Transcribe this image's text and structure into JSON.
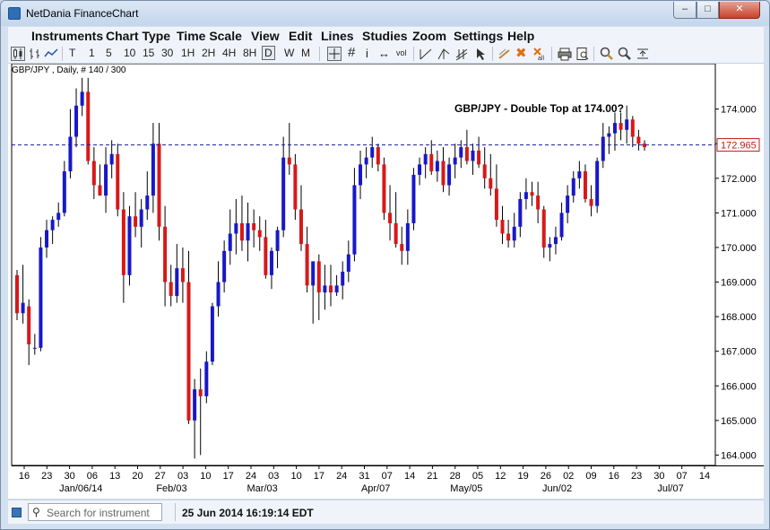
{
  "window": {
    "title": "NetDania FinanceChart",
    "controls": {
      "minimize": "–",
      "maximize": "□",
      "close": "✕"
    }
  },
  "menu": [
    "Instruments",
    "Chart Type",
    "Time Scale",
    "View",
    "Edit",
    "Lines",
    "Studies",
    "Zoom",
    "Settings",
    "Help"
  ],
  "toolbar": {
    "intervals": [
      "T",
      "1",
      "5",
      "10",
      "15",
      "30",
      "1H",
      "2H",
      "4H",
      "8H",
      "D",
      "W",
      "M"
    ],
    "selected_interval": "D",
    "icons": [
      "candlestick-icon",
      "bar-chart-icon",
      "line-chart-icon",
      "crosshair-icon",
      "grid-icon",
      "info-icon",
      "pan-icon",
      "volume-icon",
      "trendline-icon",
      "fork-icon",
      "channel-icon",
      "cursor-icon",
      "draw-icon",
      "delete-icon",
      "delete-all-icon",
      "print-icon",
      "print-preview-icon",
      "zoom-in-icon",
      "zoom-out-icon",
      "fit-icon"
    ],
    "icon_glyphs": {
      "info-icon": "i",
      "pan-icon": "↔",
      "volume-icon": "vol",
      "delete-icon": "✖",
      "grid-icon": "#"
    }
  },
  "chart_info": "GBP/JPY , Daily, # 140 / 300",
  "chart_data": {
    "type": "candlestick",
    "title": "GBP/JPY - Double Top at 174.00?",
    "instrument": "GBP/JPY",
    "interval": "Daily",
    "ylim": [
      163.7,
      174.95
    ],
    "yticks": [
      "164.000",
      "165.000",
      "166.000",
      "167.000",
      "168.000",
      "169.000",
      "170.000",
      "171.000",
      "172.000",
      "173.000",
      "174.000"
    ],
    "x_ticks": [
      "16",
      "23",
      "30",
      "06",
      "13",
      "20",
      "27",
      "03",
      "10",
      "17",
      "24",
      "03",
      "10",
      "17",
      "24",
      "31",
      "07",
      "14",
      "21",
      "28",
      "05",
      "12",
      "19",
      "26",
      "02",
      "09",
      "16",
      "23",
      "30",
      "07",
      "14"
    ],
    "x_month_labels": [
      {
        "after_tick": 3,
        "label": "Jan/06/14"
      },
      {
        "after_tick": 7,
        "label": "Feb/03"
      },
      {
        "after_tick": 11,
        "label": "Mar/03"
      },
      {
        "after_tick": 16,
        "label": "Apr/07"
      },
      {
        "after_tick": 20,
        "label": "May/05"
      },
      {
        "after_tick": 24,
        "label": "Jun/02"
      },
      {
        "after_tick": 29,
        "label": "Jul/07"
      }
    ],
    "current_price": "172.965",
    "current_level": 172.965,
    "up_color": "#1818c8",
    "down_color": "#d81818",
    "candles": [
      [
        169.2,
        169.35,
        167.9,
        168.1
      ],
      [
        168.1,
        169.5,
        167.8,
        168.4
      ],
      [
        168.3,
        168.5,
        166.6,
        167.2
      ],
      [
        167.1,
        167.5,
        166.9,
        167.1
      ],
      [
        167.1,
        170.3,
        167.0,
        170.0
      ],
      [
        170.0,
        170.8,
        169.7,
        170.5
      ],
      [
        170.5,
        170.9,
        170.1,
        170.8
      ],
      [
        170.8,
        171.3,
        170.6,
        171.0
      ],
      [
        171.0,
        172.5,
        170.9,
        172.2
      ],
      [
        172.2,
        174.0,
        172.0,
        173.2
      ],
      [
        173.2,
        174.6,
        172.9,
        174.1
      ],
      [
        174.1,
        174.9,
        173.8,
        174.5
      ],
      [
        174.5,
        174.9,
        172.4,
        172.5
      ],
      [
        172.5,
        172.9,
        171.4,
        171.8
      ],
      [
        171.8,
        172.4,
        171.5,
        171.5
      ],
      [
        171.5,
        172.9,
        171.0,
        172.4
      ],
      [
        172.4,
        173.1,
        172.0,
        172.7
      ],
      [
        172.7,
        173.0,
        170.9,
        171.1
      ],
      [
        171.1,
        171.6,
        168.4,
        169.2
      ],
      [
        169.2,
        171.2,
        168.9,
        170.9
      ],
      [
        170.9,
        171.6,
        170.3,
        170.6
      ],
      [
        170.6,
        171.4,
        170.0,
        171.1
      ],
      [
        171.1,
        172.2,
        170.8,
        171.5
      ],
      [
        171.5,
        173.6,
        171.0,
        173.0
      ],
      [
        173.0,
        173.6,
        170.2,
        170.6
      ],
      [
        170.6,
        171.2,
        168.3,
        169.0
      ],
      [
        169.0,
        169.5,
        168.3,
        168.6
      ],
      [
        168.6,
        170.1,
        168.4,
        169.4
      ],
      [
        169.4,
        170.0,
        168.4,
        169.0
      ],
      [
        169.0,
        169.9,
        164.9,
        165.0
      ],
      [
        165.0,
        166.2,
        163.9,
        165.9
      ],
      [
        165.9,
        166.5,
        164.0,
        165.7
      ],
      [
        165.7,
        167.0,
        165.5,
        166.7
      ],
      [
        166.7,
        168.4,
        166.6,
        168.3
      ],
      [
        168.3,
        169.6,
        168.0,
        169.0
      ],
      [
        169.0,
        170.2,
        168.7,
        169.9
      ],
      [
        169.9,
        171.1,
        169.5,
        170.4
      ],
      [
        170.4,
        171.4,
        169.8,
        170.7
      ],
      [
        170.7,
        171.5,
        169.9,
        170.2
      ],
      [
        170.2,
        171.3,
        169.6,
        170.7
      ],
      [
        170.7,
        171.1,
        170.0,
        170.5
      ],
      [
        170.5,
        170.9,
        169.9,
        170.3
      ],
      [
        170.3,
        170.8,
        169.1,
        169.2
      ],
      [
        169.2,
        170.0,
        168.8,
        169.9
      ],
      [
        169.9,
        170.6,
        169.4,
        170.5
      ],
      [
        170.5,
        173.2,
        170.3,
        172.6
      ],
      [
        172.6,
        173.6,
        172.1,
        172.4
      ],
      [
        172.4,
        172.7,
        170.8,
        171.1
      ],
      [
        171.1,
        171.8,
        169.9,
        170.1
      ],
      [
        170.1,
        170.6,
        168.7,
        168.9
      ],
      [
        168.9,
        169.6,
        167.8,
        169.6
      ],
      [
        169.6,
        169.8,
        167.9,
        168.7
      ],
      [
        168.7,
        169.5,
        168.2,
        168.9
      ],
      [
        168.9,
        169.5,
        168.3,
        168.7
      ],
      [
        168.7,
        169.2,
        168.6,
        168.9
      ],
      [
        168.9,
        169.6,
        168.5,
        169.3
      ],
      [
        169.3,
        170.2,
        169.0,
        169.8
      ],
      [
        169.8,
        172.3,
        169.6,
        171.8
      ],
      [
        171.8,
        172.8,
        171.4,
        172.4
      ],
      [
        172.4,
        172.9,
        172.0,
        172.6
      ],
      [
        172.6,
        173.2,
        172.3,
        172.9
      ],
      [
        172.9,
        173.0,
        172.2,
        172.4
      ],
      [
        172.4,
        172.6,
        170.8,
        171.0
      ],
      [
        171.0,
        171.8,
        170.2,
        170.7
      ],
      [
        170.7,
        171.6,
        170.0,
        170.1
      ],
      [
        170.1,
        170.6,
        169.5,
        169.9
      ],
      [
        169.9,
        171.1,
        169.5,
        170.7
      ],
      [
        170.7,
        172.3,
        170.5,
        172.1
      ],
      [
        172.1,
        172.6,
        171.8,
        172.4
      ],
      [
        172.4,
        172.9,
        172.0,
        172.7
      ],
      [
        172.7,
        173.1,
        172.1,
        172.2
      ],
      [
        172.2,
        172.8,
        171.9,
        172.5
      ],
      [
        172.5,
        172.9,
        171.6,
        171.8
      ],
      [
        171.8,
        172.6,
        171.5,
        172.4
      ],
      [
        172.4,
        173.0,
        172.0,
        172.6
      ],
      [
        172.6,
        173.1,
        172.3,
        172.9
      ],
      [
        172.9,
        173.4,
        172.4,
        172.5
      ],
      [
        172.5,
        173.0,
        172.1,
        172.8
      ],
      [
        172.8,
        173.2,
        172.3,
        172.4
      ],
      [
        172.4,
        172.9,
        171.7,
        172.0
      ],
      [
        172.0,
        172.7,
        171.5,
        171.7
      ],
      [
        171.7,
        172.4,
        170.6,
        170.8
      ],
      [
        170.8,
        171.2,
        170.1,
        170.4
      ],
      [
        170.4,
        170.8,
        170.0,
        170.2
      ],
      [
        170.2,
        171.0,
        170.0,
        170.6
      ],
      [
        170.6,
        171.6,
        170.3,
        171.4
      ],
      [
        171.4,
        172.0,
        171.1,
        171.6
      ],
      [
        171.6,
        171.9,
        171.2,
        171.5
      ],
      [
        171.5,
        171.9,
        170.7,
        171.1
      ],
      [
        171.1,
        171.2,
        169.7,
        170.0
      ],
      [
        170.0,
        170.3,
        169.6,
        170.1
      ],
      [
        170.1,
        170.6,
        169.8,
        170.3
      ],
      [
        170.3,
        171.3,
        170.2,
        171.0
      ],
      [
        171.0,
        171.8,
        170.7,
        171.5
      ],
      [
        171.5,
        172.2,
        171.3,
        172.0
      ],
      [
        172.0,
        172.5,
        171.7,
        172.2
      ],
      [
        172.2,
        172.4,
        171.3,
        171.4
      ],
      [
        171.4,
        171.8,
        170.9,
        171.2
      ],
      [
        171.2,
        172.6,
        171.0,
        172.5
      ],
      [
        172.5,
        173.6,
        172.3,
        173.2
      ],
      [
        173.2,
        173.5,
        172.7,
        173.3
      ],
      [
        173.3,
        173.9,
        172.8,
        173.6
      ],
      [
        173.6,
        173.9,
        173.1,
        173.4
      ],
      [
        173.4,
        174.1,
        173.0,
        173.7
      ],
      [
        173.7,
        173.8,
        172.9,
        173.2
      ],
      [
        173.2,
        173.4,
        172.8,
        173.0
      ],
      [
        173.0,
        173.1,
        172.8,
        172.9
      ]
    ]
  },
  "status": {
    "search_placeholder": "Search for instrument",
    "datetime": "25 Jun 2014 16:19:14 EDT"
  }
}
